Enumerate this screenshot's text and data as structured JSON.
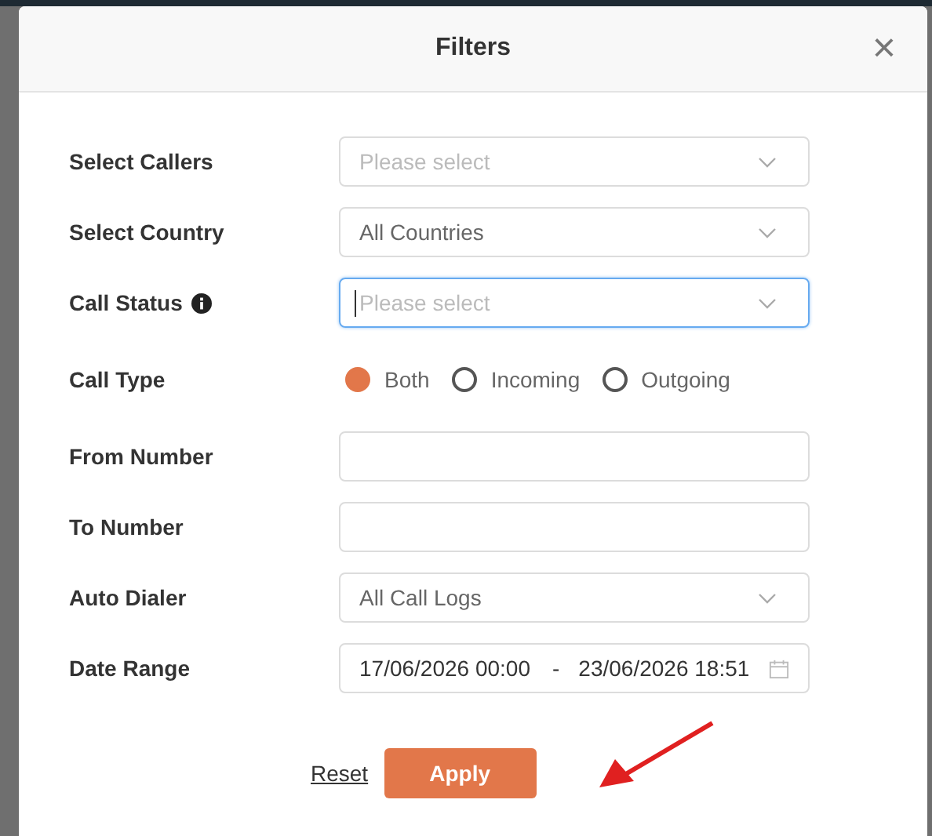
{
  "dialog": {
    "title": "Filters",
    "close_glyph": "×"
  },
  "fields": [
    {
      "kind": "select",
      "label": "Select Callers",
      "placeholder": "Please select",
      "focused": false
    },
    {
      "kind": "select",
      "label": "Select Country",
      "value": "All Countries",
      "focused": false
    },
    {
      "kind": "select",
      "label": "Call Status",
      "placeholder": "Please select",
      "focused": true,
      "info": true
    },
    {
      "kind": "radio",
      "label": "Call Type",
      "options": [
        {
          "label": "Both",
          "selected": true
        },
        {
          "label": "Incoming",
          "selected": false
        },
        {
          "label": "Outgoing",
          "selected": false
        }
      ]
    },
    {
      "kind": "input",
      "label": "From Number",
      "focused": false
    },
    {
      "kind": "input",
      "label": "To Number",
      "focused": false
    },
    {
      "kind": "select",
      "label": "Auto Dialer",
      "value": "All Call Logs",
      "focused": false
    },
    {
      "kind": "daterange",
      "label": "Date Range",
      "start": "17/06/2026 00:00",
      "separator": "-",
      "end": "23/06/2026 18:51"
    }
  ],
  "buttons": {
    "reset": "Reset",
    "apply": "Apply"
  }
}
